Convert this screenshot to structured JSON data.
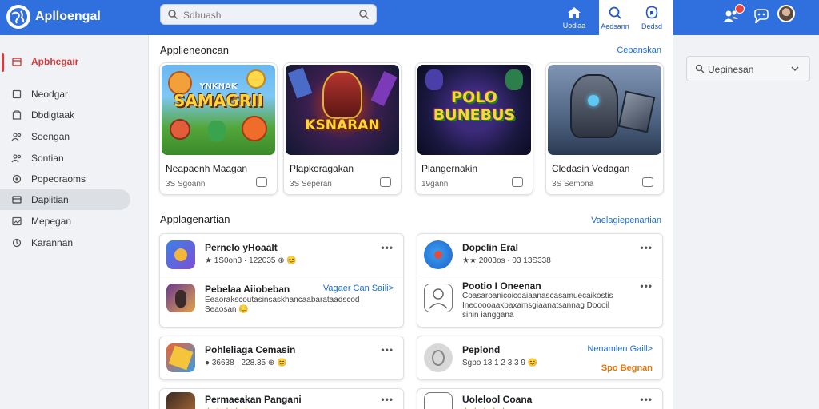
{
  "app": {
    "brand": "Aplloengal",
    "search_placeholder": "Sdhuash"
  },
  "topnav": {
    "tabs": [
      {
        "label": "Uodlaa",
        "icon": "home-icon"
      },
      {
        "label": "Aedsann",
        "icon": "search-icon"
      },
      {
        "label": "Dedsd",
        "icon": "bookmark-icon"
      }
    ],
    "notification_count": "6"
  },
  "sidebar": {
    "items": [
      {
        "label": "Apbhegair",
        "icon": "calendar-icon"
      },
      {
        "label": "Neodgar",
        "icon": "square-icon"
      },
      {
        "label": "Dbdigtaak",
        "icon": "box-icon"
      },
      {
        "label": "Soengan",
        "icon": "people-icon"
      },
      {
        "label": "Sontian",
        "icon": "people-icon"
      },
      {
        "label": "Popeoraoms",
        "icon": "gear-icon"
      },
      {
        "label": "Daplitian",
        "icon": "grid-icon"
      },
      {
        "label": "Mepegan",
        "icon": "image-icon"
      },
      {
        "label": "Karannan",
        "icon": "settings-icon"
      }
    ]
  },
  "featured": {
    "title": "Applieneoncan",
    "link": "Cepanskan",
    "cards": [
      {
        "name": "Neapaenh Maagan",
        "meta": "3S Sgoann",
        "art_title": "SAMAGRII",
        "art_sub": "YNKNAK"
      },
      {
        "name": "Plapkoragakan",
        "meta": "3S Seperan",
        "art_title": "KSNARAN",
        "art_sub": ""
      },
      {
        "name": "Plangernakin",
        "meta": "19gann",
        "art_title": "POLO BUNEBUS",
        "art_sub": ""
      },
      {
        "name": "Cledasin Vedagan",
        "meta": "3S Semona",
        "art_title": "",
        "art_sub": ""
      }
    ]
  },
  "apps": {
    "title": "Applagenartian",
    "link": "Vaelagiepenartian",
    "items": [
      {
        "name": "Pernelo yHoaalt",
        "meta": "★ 1S0on3 · 122035 ⊕ 😊"
      },
      {
        "name": "Pebelaa Aiiobeban",
        "link": "Vagaer Can Saili>",
        "desc": "Eeaorakscoutasinsaskhancaabarataadscod Seaosan 😊"
      },
      {
        "name": "Pohleliaga Cemasin",
        "meta": "● 36638 · 228.35 ⊕ 😊"
      },
      {
        "name": "Permaeakan Pangani",
        "meta": "★ ★ ★ ★ ★"
      },
      {
        "name": "Dopelin Eral",
        "meta": "★★ 2003os · 03 13S338"
      },
      {
        "name": "Pootio I Oneenan",
        "desc": "Coasaroanicoicoaiaanascasamuecaikostis Ineooooaakbaxamsgiaanatsannag Doooil sinin ianggana"
      },
      {
        "name": "Peplond",
        "link": "Nenamlen Gaill>",
        "meta": "Sgpo 13 1 2 3 3 9 😊",
        "tag": "Spo Begnan"
      },
      {
        "name": "Uolelool Coana",
        "meta": "★ ★ ★ ★ ★"
      }
    ]
  },
  "right_panel": {
    "select_label": "Uepinesan"
  },
  "colors": {
    "topbar": "#2f6fde",
    "accent": "#1f6fd1",
    "active": "#d23c3c"
  }
}
